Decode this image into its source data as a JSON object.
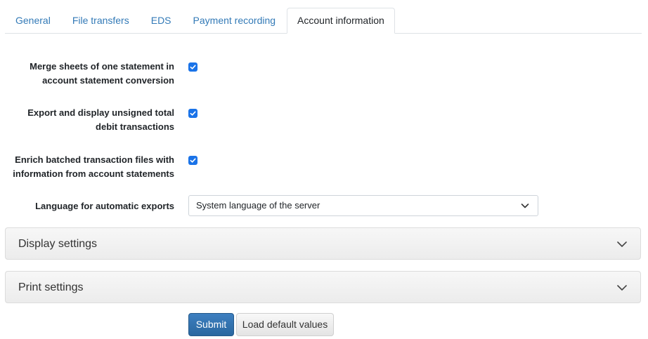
{
  "tabs": [
    {
      "label": "General",
      "active": false
    },
    {
      "label": "File transfers",
      "active": false
    },
    {
      "label": "EDS",
      "active": false
    },
    {
      "label": "Payment recording",
      "active": false
    },
    {
      "label": "Account information",
      "active": true
    }
  ],
  "form": {
    "merge_sheets": {
      "label_line1": "Merge sheets of one statement in",
      "label_line2": "account statement conversion",
      "checked": true
    },
    "unsigned_debit": {
      "label_line1": "Export and display unsigned total",
      "label_line2": "debit transactions",
      "checked": true
    },
    "enrich_batched": {
      "label_line1": "Enrich batched transaction files with",
      "label_line2": "information from account statements",
      "checked": true
    },
    "language": {
      "label": "Language for automatic exports",
      "value": "System language of the server"
    }
  },
  "panels": {
    "display": {
      "title": "Display settings",
      "expanded": false
    },
    "print": {
      "title": "Print settings",
      "expanded": false
    }
  },
  "buttons": {
    "submit": "Submit",
    "load_defaults": "Load default values"
  },
  "icons": {
    "checkbox_check": "checkmark-icon",
    "select_arrow": "chevron-down-icon",
    "panel_arrow": "chevron-down-icon"
  },
  "colors": {
    "tab_link": "#337ab7",
    "checkbox_fill": "#1a73e8",
    "primary_button": "#2f6fad"
  }
}
